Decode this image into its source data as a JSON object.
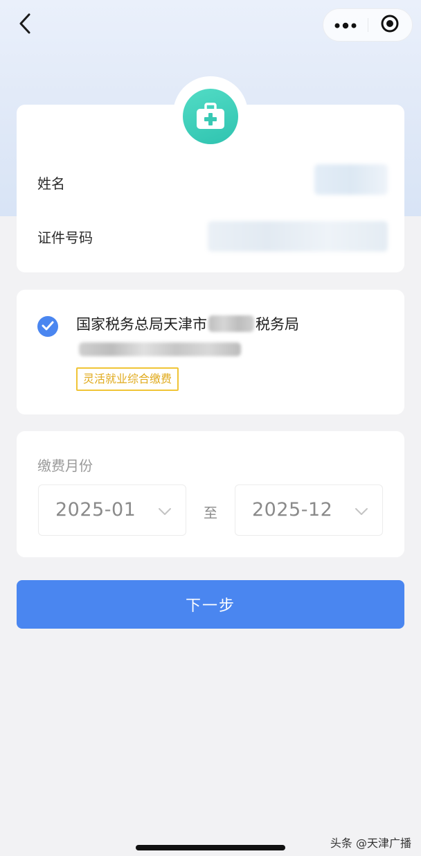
{
  "top_bar": {
    "back_icon": "chevron-left-icon",
    "more_icon": "more-dots-icon",
    "close_icon": "target-close-icon"
  },
  "identity_card": {
    "icon": "medical-kit-icon",
    "accent": "#38c9b4",
    "name_label": "姓名",
    "id_label": "证件号码"
  },
  "tax_bureau_card": {
    "check_icon": "checkmark-icon",
    "name_prefix": "国家税务总局天津市",
    "name_suffix": "税务局",
    "tag": "灵活就业综合缴费",
    "tag_color": "#e0aa1c"
  },
  "payment_card": {
    "label": "缴费月份",
    "start_month": "2025-01",
    "separator": "至",
    "end_month": "2025-12"
  },
  "next_button": {
    "label": "下一步",
    "color": "#4a86f0"
  },
  "watermark": "头条 @天津广播"
}
